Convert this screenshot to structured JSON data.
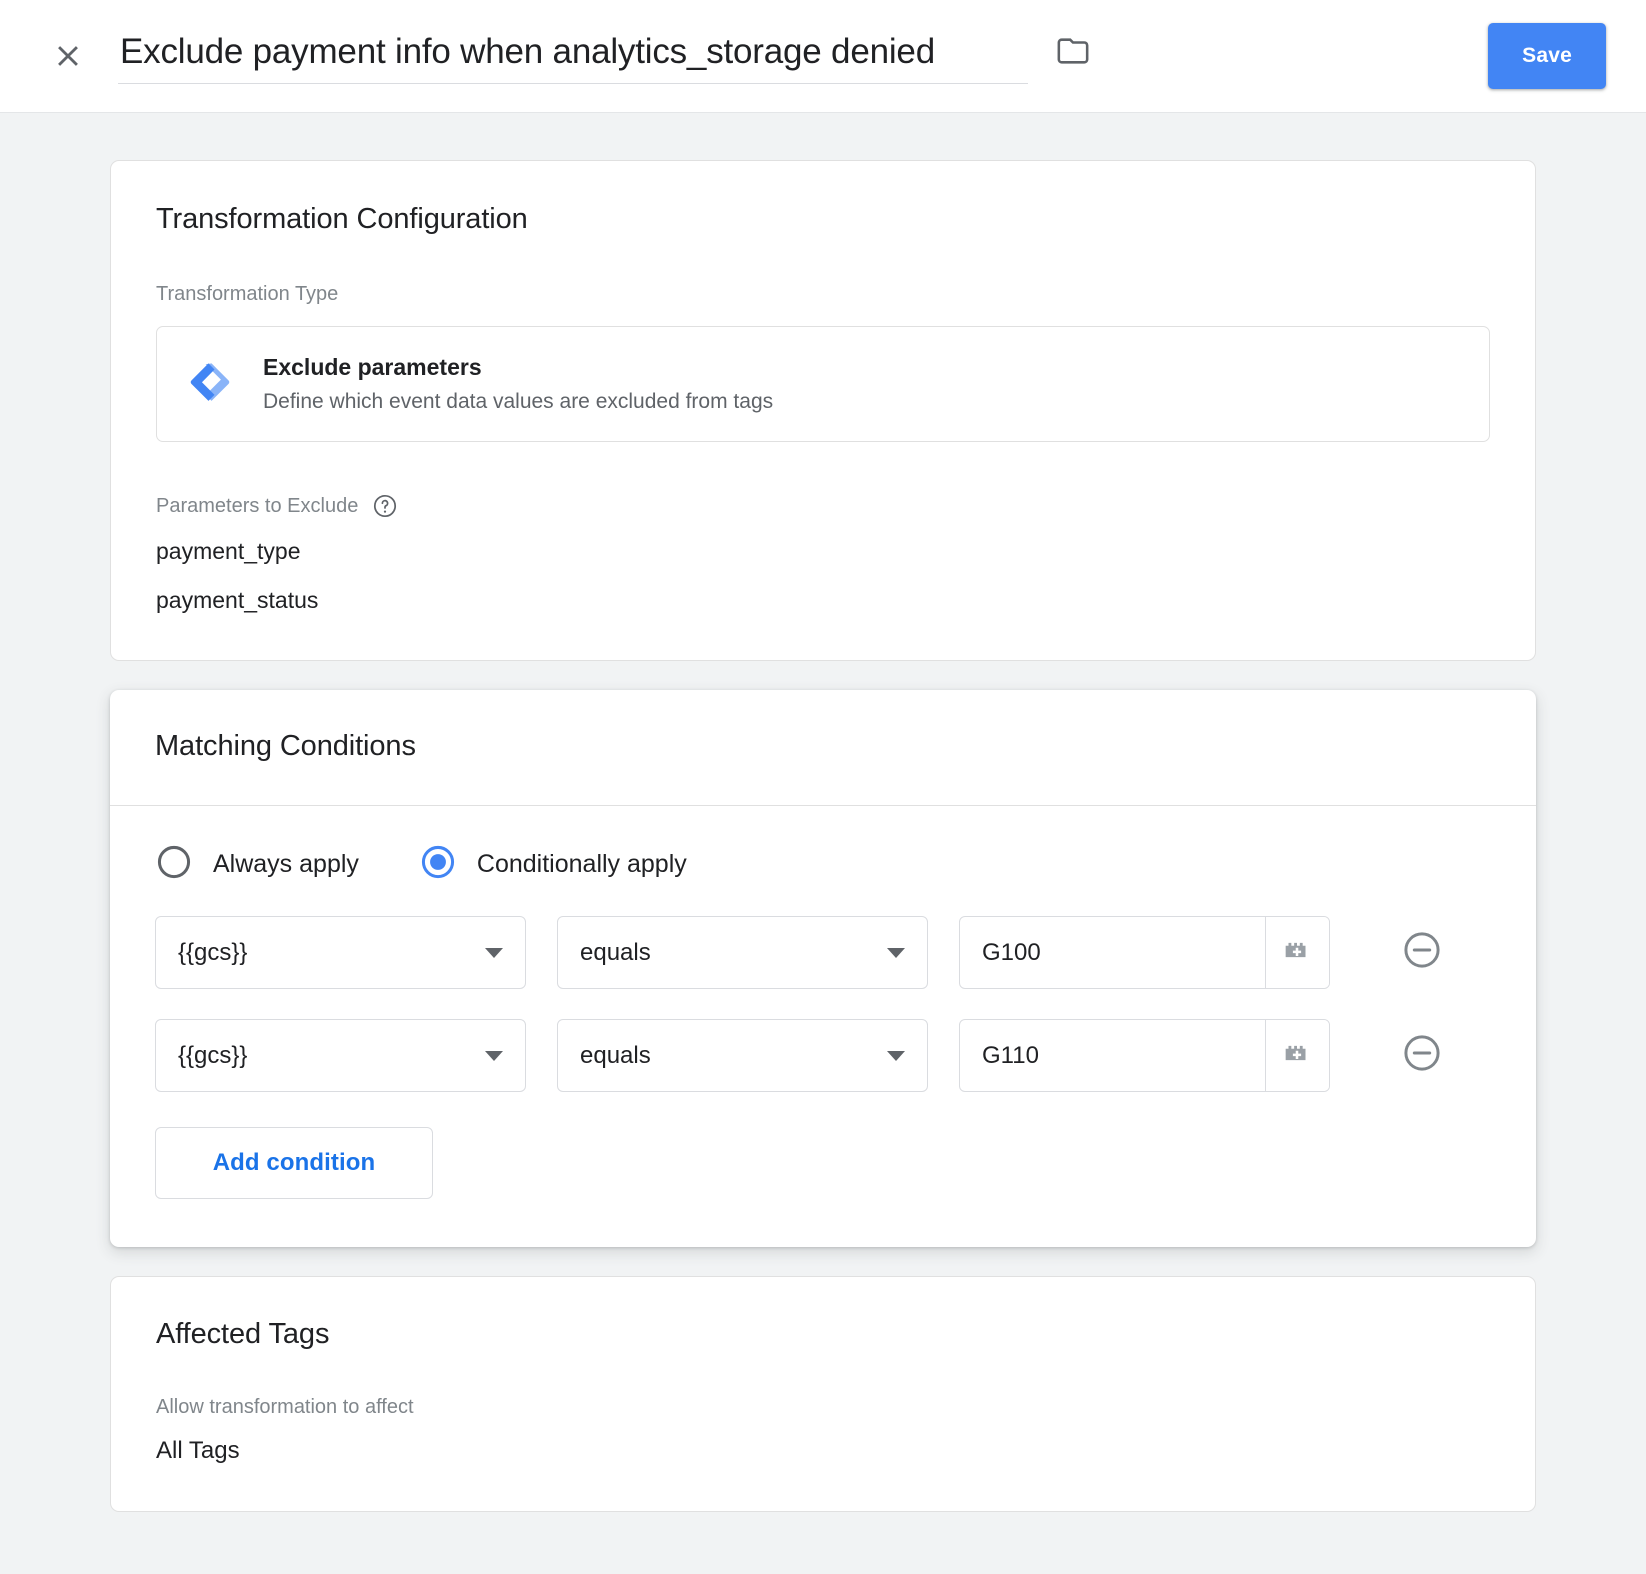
{
  "appbar": {
    "close_icon": "close-icon",
    "title_value": "Exclude payment info when analytics_storage denied",
    "title_placeholder": "Untitled Transformation",
    "folder_icon": "folder-icon",
    "save_label": "Save",
    "accent_color": "#4285f4"
  },
  "transformation_card": {
    "title": "Transformation Configuration",
    "type_field_label": "Transformation Type",
    "selected_type": {
      "icon": "gtm-diamond-icon",
      "name": "Exclude parameters",
      "description": "Define which event data values are excluded from tags"
    },
    "parameters_label": "Parameters to Exclude",
    "help_icon": "help-circle-icon",
    "parameters": [
      "payment_type",
      "payment_status"
    ]
  },
  "matching_card": {
    "title": "Matching Conditions",
    "apply_mode_options": [
      {
        "label": "Always apply",
        "selected": false
      },
      {
        "label": "Conditionally apply",
        "selected": true
      }
    ],
    "selected_apply_mode": "Conditionally apply",
    "conditions": [
      {
        "variable": "{{gcs}}",
        "operator": "equals",
        "value": "G100",
        "value_placeholder": "",
        "variable_picker_icon": "lego-brick-plus-icon",
        "remove_icon": "remove-circle-icon"
      },
      {
        "variable": "{{gcs}}",
        "operator": "equals",
        "value": "G110",
        "value_placeholder": "",
        "variable_picker_icon": "lego-brick-plus-icon",
        "remove_icon": "remove-circle-icon"
      }
    ],
    "add_condition_label": "Add condition",
    "link_color": "#1a73e8"
  },
  "affected_tags_card": {
    "title": "Affected Tags",
    "sub_label": "Allow transformation to affect",
    "value": "All Tags"
  }
}
